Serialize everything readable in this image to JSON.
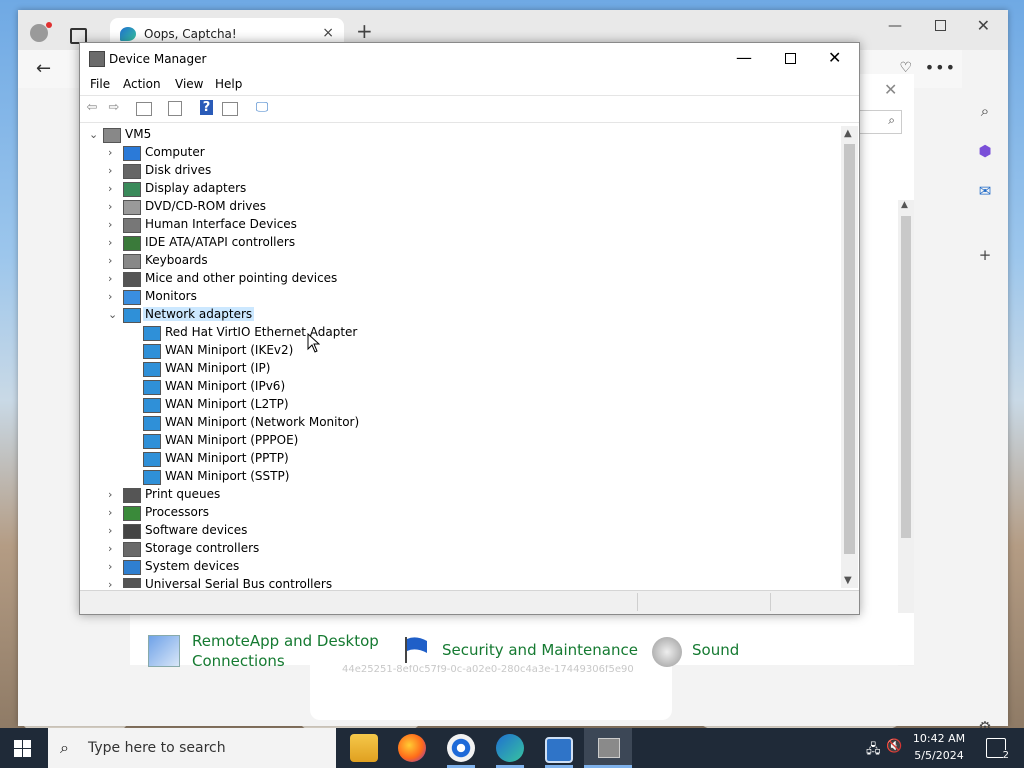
{
  "browser": {
    "tab_title": "Oops, Captcha!",
    "tab_close": "×",
    "new_tab": "+",
    "more": "•••",
    "window": {
      "minimize": "—",
      "close": "✕"
    }
  },
  "web": {
    "guid_text": "44e25251-8ef0c57f9-0c-a02e0-280c4a3e-17449306f5e90",
    "control_panel_items": [
      {
        "label_line1": "RemoteApp and Desktop",
        "label_line2": "Connections"
      },
      {
        "label": "Security and Maintenance"
      },
      {
        "label": "Sound"
      }
    ]
  },
  "device_manager": {
    "title": "Device Manager",
    "controls": {
      "minimize": "—",
      "close": "✕"
    },
    "menu": [
      "File",
      "Action",
      "View",
      "Help"
    ],
    "root": "VM5",
    "tree": [
      {
        "label": "Computer",
        "expanded": false
      },
      {
        "label": "Disk drives",
        "expanded": false
      },
      {
        "label": "Display adapters",
        "expanded": false
      },
      {
        "label": "DVD/CD-ROM drives",
        "expanded": false
      },
      {
        "label": "Human Interface Devices",
        "expanded": false
      },
      {
        "label": "IDE ATA/ATAPI controllers",
        "expanded": false
      },
      {
        "label": "Keyboards",
        "expanded": false
      },
      {
        "label": "Mice and other pointing devices",
        "expanded": false
      },
      {
        "label": "Monitors",
        "expanded": false
      },
      {
        "label": "Network adapters",
        "expanded": true,
        "selected": true,
        "children": [
          "Red Hat VirtIO Ethernet Adapter",
          "WAN Miniport (IKEv2)",
          "WAN Miniport (IP)",
          "WAN Miniport (IPv6)",
          "WAN Miniport (L2TP)",
          "WAN Miniport (Network Monitor)",
          "WAN Miniport (PPPOE)",
          "WAN Miniport (PPTP)",
          "WAN Miniport (SSTP)"
        ]
      },
      {
        "label": "Print queues",
        "expanded": false
      },
      {
        "label": "Processors",
        "expanded": false
      },
      {
        "label": "Software devices",
        "expanded": false
      },
      {
        "label": "Storage controllers",
        "expanded": false
      },
      {
        "label": "System devices",
        "expanded": false
      },
      {
        "label": "Universal Serial Bus controllers",
        "expanded": false
      }
    ]
  },
  "taskbar": {
    "search_placeholder": "Type here to search",
    "time": "10:42 AM",
    "date": "5/5/2024",
    "notification_count": "2"
  },
  "colors": {
    "selection": "#cce8ff",
    "link_green": "#157a31",
    "taskbar": "#1f2a38"
  }
}
